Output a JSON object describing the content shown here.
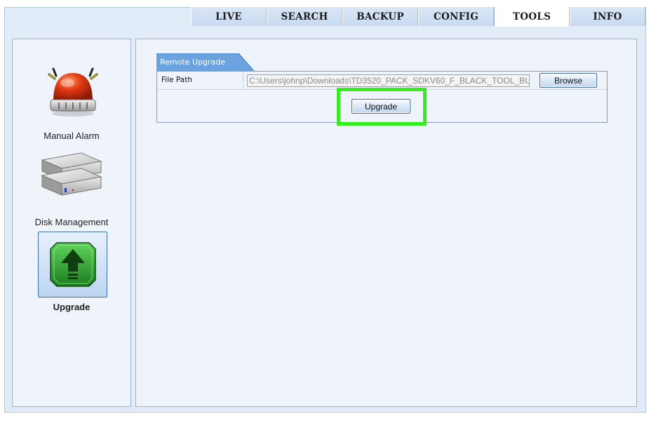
{
  "tabs": [
    {
      "label": "LIVE",
      "active": false
    },
    {
      "label": "SEARCH",
      "active": false
    },
    {
      "label": "BACKUP",
      "active": false
    },
    {
      "label": "CONFIG",
      "active": false
    },
    {
      "label": "TOOLS",
      "active": true
    },
    {
      "label": "INFO",
      "active": false
    }
  ],
  "sidebar": {
    "items": [
      {
        "label": "Manual Alarm",
        "icon": "alarm-siren-icon",
        "selected": false
      },
      {
        "label": "Disk Management",
        "icon": "hard-disk-icon",
        "selected": false
      },
      {
        "label": "Upgrade",
        "icon": "upgrade-arrow-icon",
        "selected": true
      }
    ]
  },
  "section": {
    "title": "Remote Upgrade",
    "file_path_label": "File Path",
    "file_path_value": "C:\\Users\\johnp\\Downloads\\TD3520_PACK_SDKV60_F_BLACK_TOOL_BU",
    "browse_label": "Browse",
    "upgrade_label": "Upgrade"
  },
  "colors": {
    "highlight": "#33ee1f",
    "tab_active": "#ffffff",
    "panel_background": "#eff4fb",
    "section_tab": "#6aa3e0"
  }
}
